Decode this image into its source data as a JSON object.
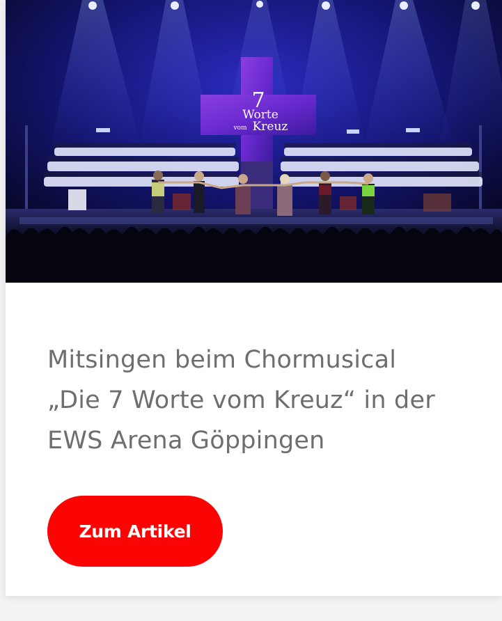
{
  "card": {
    "image": {
      "alt": "Chormusical 7 Worte vom Kreuz auf der Bühne",
      "screen_text": {
        "number": "7",
        "word1": "Worte",
        "word2_small": "vom",
        "word2_big": "Kreuz"
      }
    },
    "title_lines": [
      "Mitsingen beim Chormusical",
      "„Die 7 Worte vom Kreuz“ in der",
      "EWS Arena Göppingen"
    ],
    "cta_label": "Zum Artikel",
    "colors": {
      "cta_background": "#fa0404",
      "title_text": "#6e6e6e",
      "card_background": "#ffffff"
    }
  }
}
